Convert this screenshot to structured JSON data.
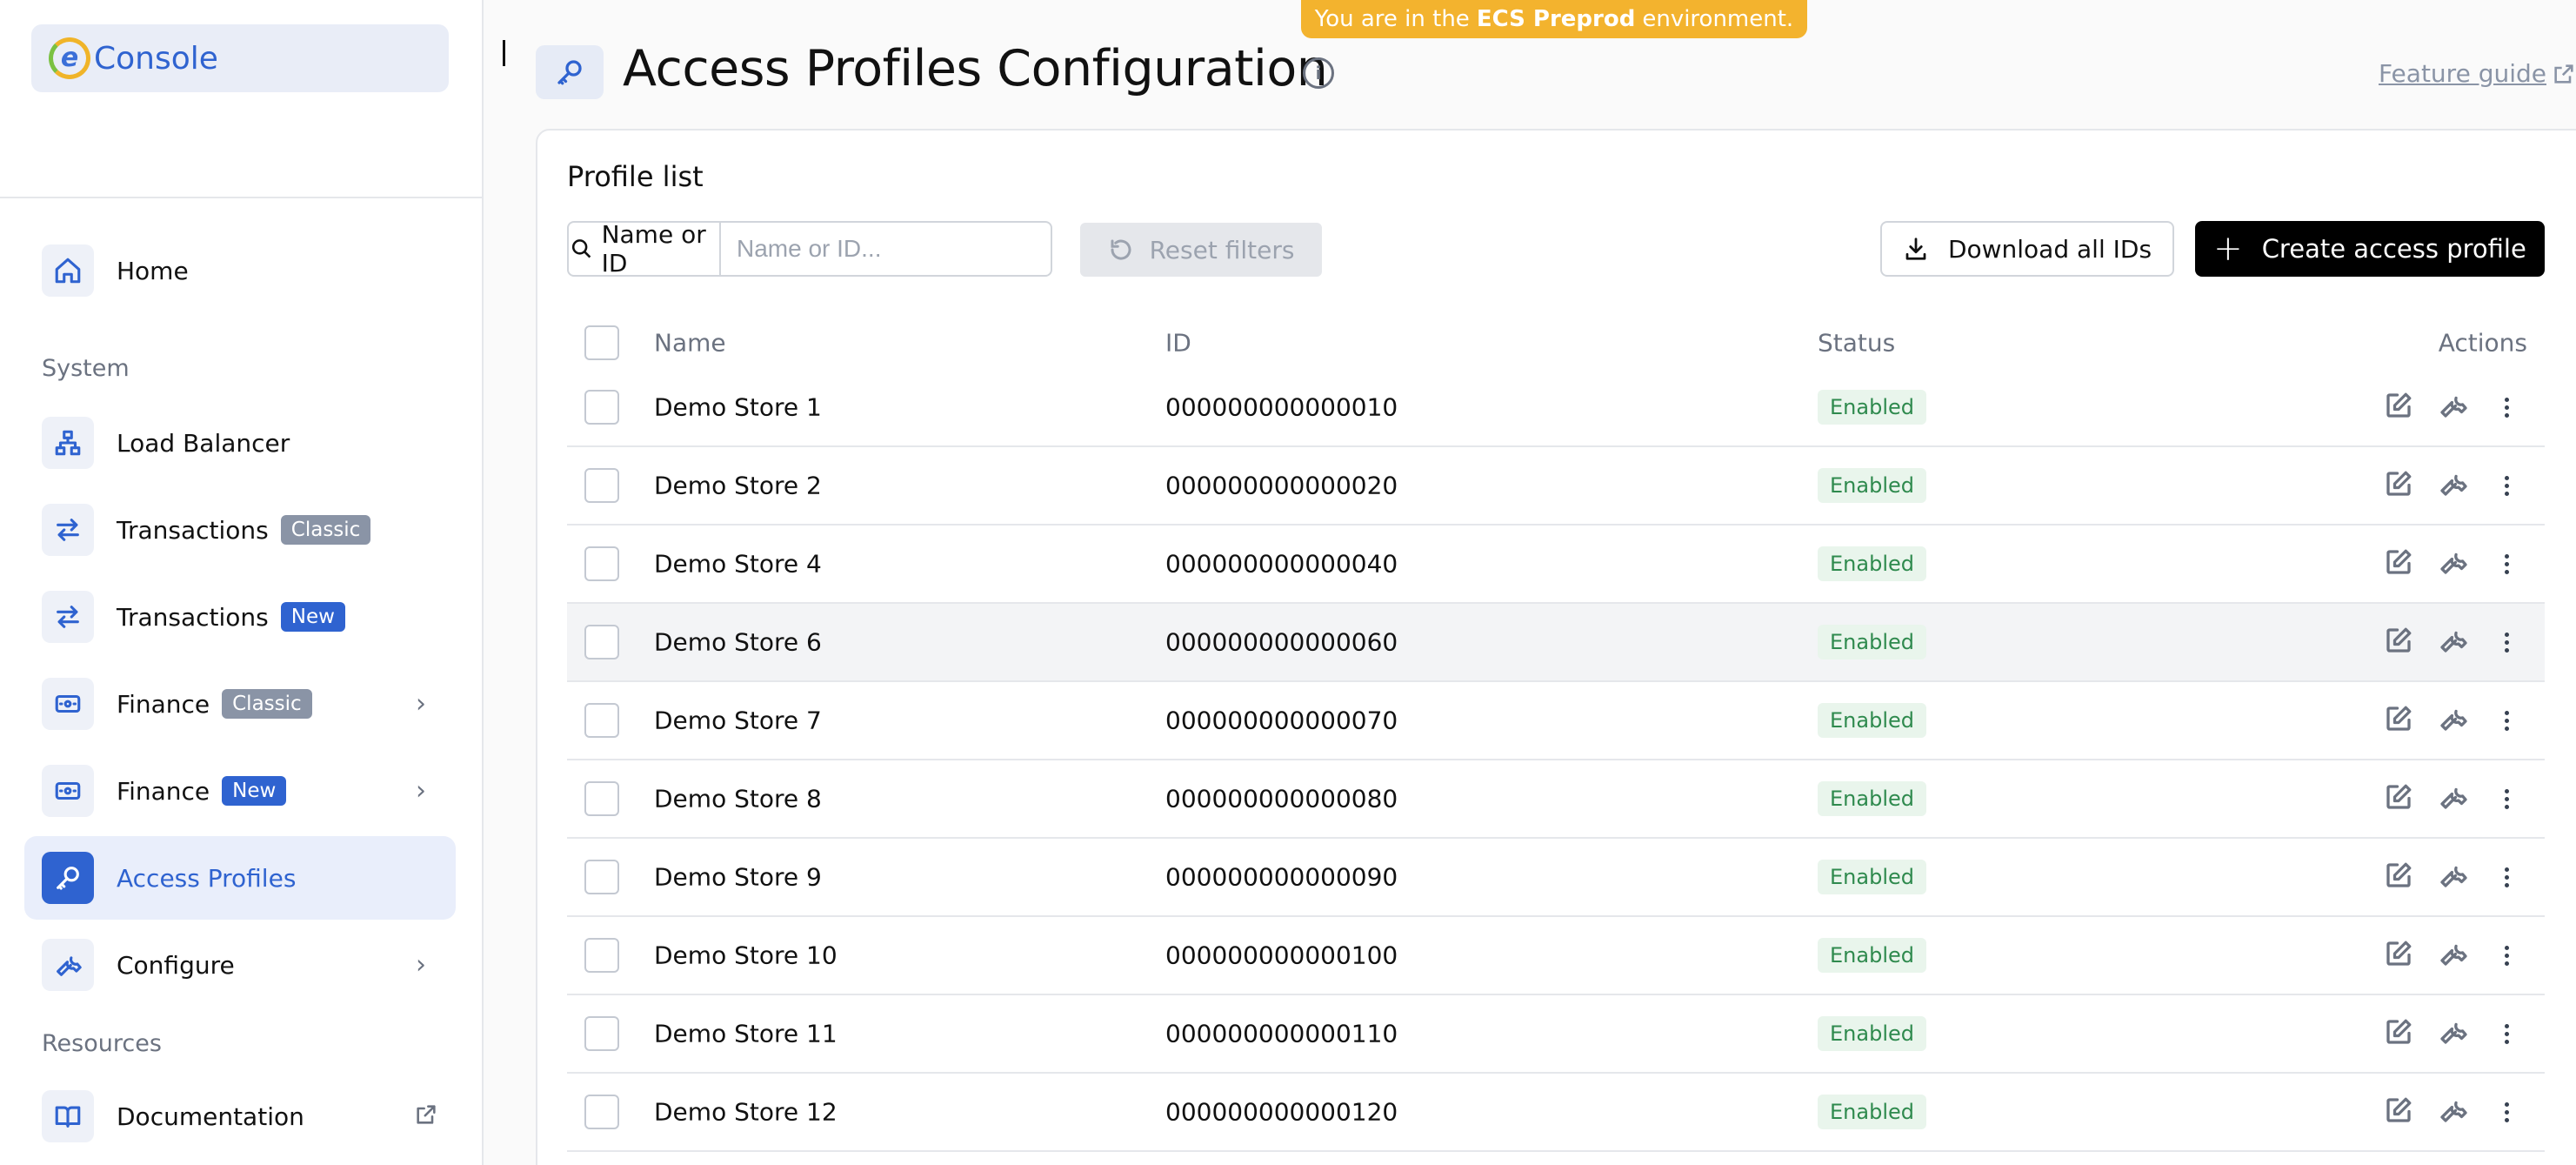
{
  "logo": {
    "letter": "e",
    "text": "Console"
  },
  "env_banner": {
    "prefix": "You are in the",
    "env": "ECS Preprod",
    "suffix": "environment."
  },
  "sidebar": {
    "home": "Home",
    "sections": {
      "system": "System",
      "resources": "Resources"
    },
    "items": [
      {
        "label": "Load Balancer",
        "icon": "network-icon"
      },
      {
        "label": "Transactions",
        "badge": "Classic",
        "icon": "arrows-icon"
      },
      {
        "label": "Transactions",
        "badge": "New",
        "icon": "arrows-icon"
      },
      {
        "label": "Finance",
        "badge": "Classic",
        "icon": "cash-icon",
        "chevron": true
      },
      {
        "label": "Finance",
        "badge": "New",
        "icon": "cash-icon",
        "chevron": true
      },
      {
        "label": "Access Profiles",
        "icon": "key-icon",
        "active": true
      },
      {
        "label": "Configure",
        "icon": "wrench-icon",
        "chevron": true
      }
    ],
    "documentation": "Documentation"
  },
  "header": {
    "title": "Access Profiles Configuration",
    "info": "i",
    "guide": "Feature guide"
  },
  "card": {
    "title": "Profile list",
    "filter_label": "Name or ID",
    "filter_placeholder": "Name or ID...",
    "reset": "Reset filters",
    "download": "Download all IDs",
    "create": "Create access profile",
    "create_plus": "+"
  },
  "table": {
    "headers": {
      "name": "Name",
      "id": "ID",
      "status": "Status",
      "actions": "Actions"
    },
    "rows": [
      {
        "name": "Demo Store 1",
        "id": "000000000000010",
        "status": "Enabled"
      },
      {
        "name": "Demo Store 2",
        "id": "000000000000020",
        "status": "Enabled"
      },
      {
        "name": "Demo Store 4",
        "id": "000000000000040",
        "status": "Enabled"
      },
      {
        "name": "Demo Store 6",
        "id": "000000000000060",
        "status": "Enabled"
      },
      {
        "name": "Demo Store 7",
        "id": "000000000000070",
        "status": "Enabled"
      },
      {
        "name": "Demo Store 8",
        "id": "000000000000080",
        "status": "Enabled"
      },
      {
        "name": "Demo Store 9",
        "id": "000000000000090",
        "status": "Enabled"
      },
      {
        "name": "Demo Store 10",
        "id": "000000000000100",
        "status": "Enabled"
      },
      {
        "name": "Demo Store 11",
        "id": "000000000000110",
        "status": "Enabled"
      },
      {
        "name": "Demo Store 12",
        "id": "000000000000120",
        "status": "Enabled"
      }
    ]
  },
  "colors": {
    "accent": "#2f63d0",
    "banner": "#f3b32e",
    "status_text": "#2f8a4e",
    "status_bg": "#e9f5ec"
  }
}
